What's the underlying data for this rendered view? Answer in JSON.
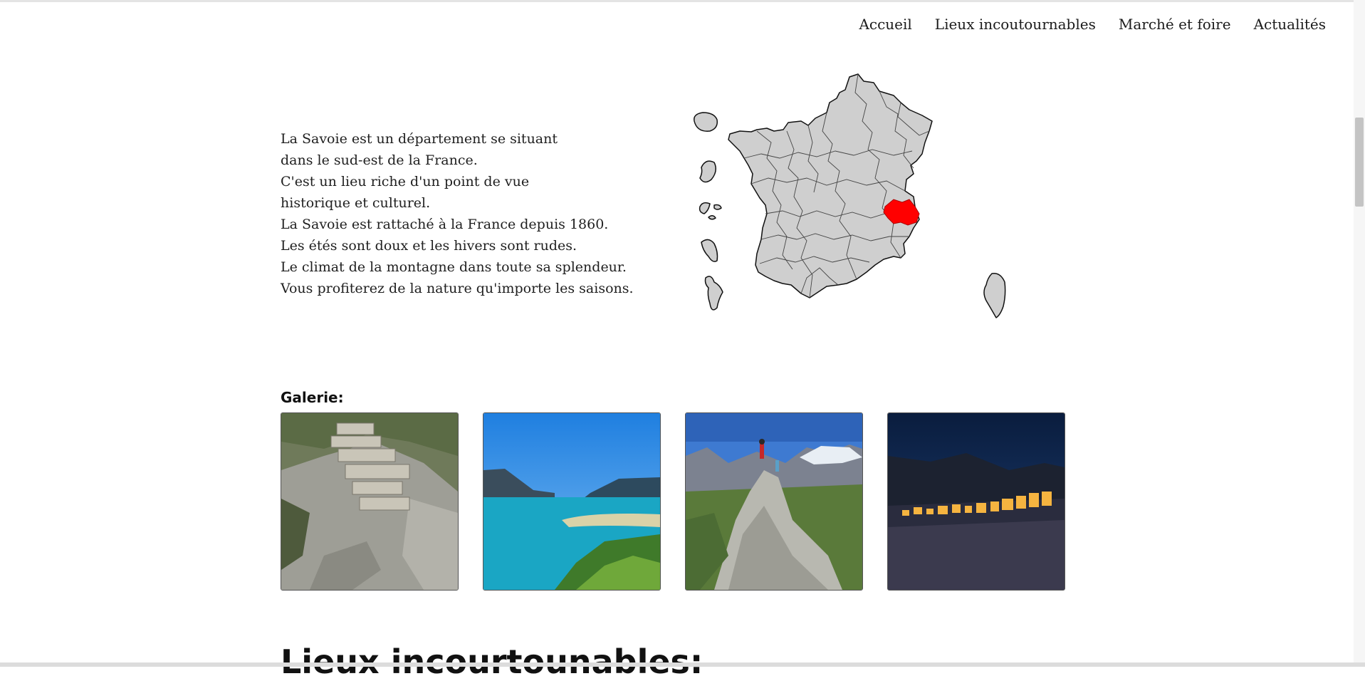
{
  "nav": {
    "items": [
      {
        "label": "Accueil"
      },
      {
        "label": "Lieux incoutournables"
      },
      {
        "label": "Marché et foire"
      },
      {
        "label": "Actualités"
      }
    ]
  },
  "intro": {
    "lines": [
      "La Savoie est un département se situant",
      "dans le sud-est de la France.",
      "C'est un lieu riche d'un point de vue",
      "historique et culturel.",
      "La Savoie est rattaché à la France depuis 1860.",
      "Les étés sont doux et les hivers sont rudes.",
      "Le climat de la montagne dans toute sa splendeur.",
      "Vous profiterez de la nature qu'importe les saisons."
    ]
  },
  "map": {
    "highlight_color": "#ff0000",
    "land_color": "#cfcfcf",
    "border_color": "#111111"
  },
  "gallery": {
    "title": "Galerie:",
    "images": [
      {
        "icon": "fortress-photo"
      },
      {
        "icon": "lake-photo"
      },
      {
        "icon": "mountain-summit-photo"
      },
      {
        "icon": "ski-resort-night-photo"
      }
    ]
  },
  "section": {
    "title": "Lieux incourtounables:"
  }
}
